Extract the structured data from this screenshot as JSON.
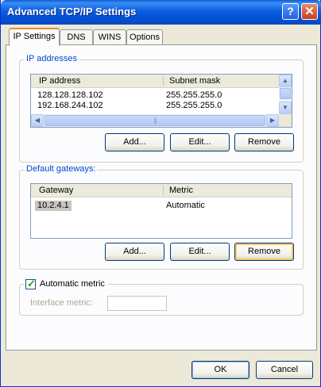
{
  "window": {
    "title": "Advanced TCP/IP Settings",
    "help_button": "?",
    "close_button": "✕"
  },
  "tabs": [
    {
      "label": "IP Settings",
      "active": true
    },
    {
      "label": "DNS",
      "active": false
    },
    {
      "label": "WINS",
      "active": false
    },
    {
      "label": "Options",
      "active": false
    }
  ],
  "ip_group": {
    "label": "IP addresses",
    "columns": [
      "IP address",
      "Subnet mask"
    ],
    "rows": [
      {
        "ip": "128.128.128.102",
        "mask": "255.255.255.0"
      },
      {
        "ip": "192.168.244.102",
        "mask": "255.255.255.0"
      }
    ],
    "buttons": {
      "add": "Add...",
      "edit": "Edit...",
      "remove": "Remove"
    }
  },
  "gateway_group": {
    "label": "Default gateways:",
    "columns": [
      "Gateway",
      "Metric"
    ],
    "rows": [
      {
        "gateway": "10.2.4.1",
        "metric": "Automatic"
      }
    ],
    "buttons": {
      "add": "Add...",
      "edit": "Edit...",
      "remove": "Remove"
    }
  },
  "metric_group": {
    "automatic_metric_label": "Automatic metric",
    "automatic_metric_checked": true,
    "interface_metric_label": "Interface metric:",
    "interface_metric_value": ""
  },
  "footer": {
    "ok": "OK",
    "cancel": "Cancel"
  }
}
